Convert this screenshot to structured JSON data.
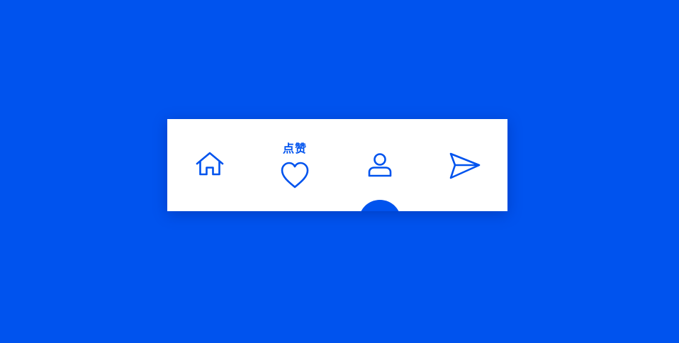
{
  "colors": {
    "background": "#0053ee",
    "accent": "#0053ee",
    "bar": "#ffffff"
  },
  "tabbar": {
    "active_index": 1,
    "items": [
      {
        "id": "home",
        "icon": "home-icon",
        "label": ""
      },
      {
        "id": "like",
        "icon": "heart-icon",
        "label": "点赞"
      },
      {
        "id": "profile",
        "icon": "user-icon",
        "label": ""
      },
      {
        "id": "send",
        "icon": "send-icon",
        "label": ""
      }
    ]
  }
}
